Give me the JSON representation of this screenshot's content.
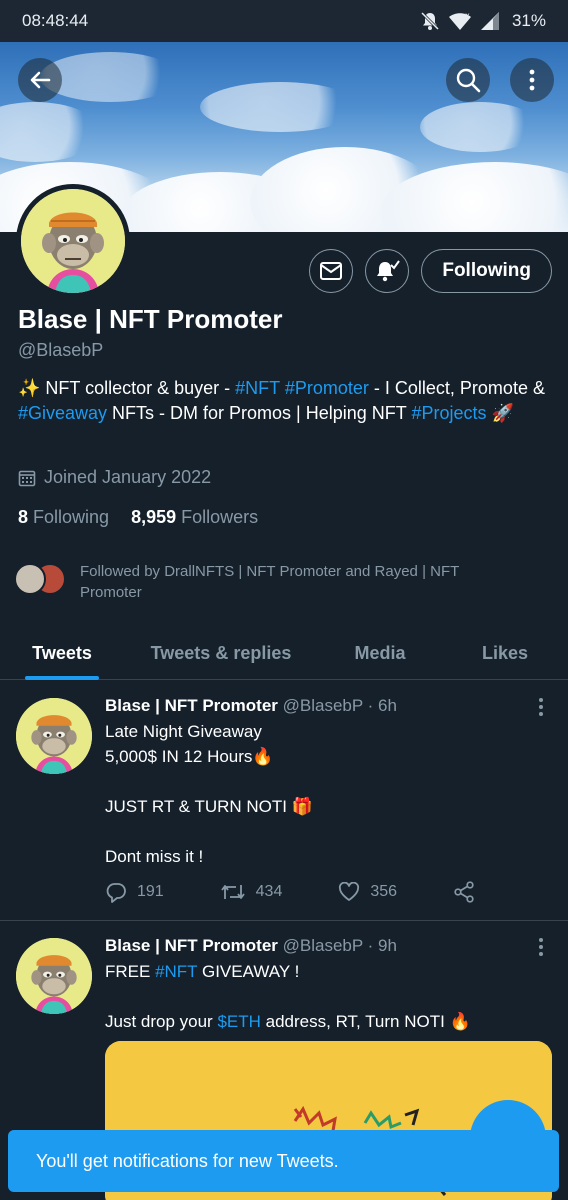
{
  "status_bar": {
    "time": "08:48:44",
    "battery": "31%"
  },
  "profile": {
    "name": "Blase | NFT Promoter",
    "handle": "@BlasebP",
    "bio": {
      "emoji_start": "✨",
      "t1": " NFT collector & buyer - ",
      "h1": "#NFT",
      "h2": "#Promoter",
      "t2": " - I Collect, Promote & ",
      "h3": "#Giveaway",
      "t3": " NFTs - DM for Promos | Helping NFT ",
      "h4": "#Projects",
      "emoji_end": "🚀"
    },
    "joined": "Joined January 2022",
    "following_count": "8",
    "following_label": "Following",
    "followers_count": "8,959",
    "followers_label": "Followers",
    "followed_by": "Followed by DrallNFTS | NFT Promoter and Rayed | NFT Promoter",
    "following_button": "Following"
  },
  "tabs": [
    "Tweets",
    "Tweets & replies",
    "Media",
    "Likes"
  ],
  "tweets": [
    {
      "name": "Blase | NFT Promoter",
      "handle": "@BlasebP",
      "time": "· 6h",
      "line1": "Late Night Giveaway",
      "line2": "5,000$ IN 12 Hours",
      "line2_emoji": "🔥",
      "line3": "JUST RT & TURN NOTI ",
      "line3_emoji": "🎁",
      "line4": "Dont miss it !",
      "replies": "191",
      "retweets": "434",
      "likes": "356"
    },
    {
      "name": "Blase | NFT Promoter",
      "handle": "@BlasebP",
      "time": "· 9h",
      "line1_a": "FREE ",
      "line1_tag": "#NFT",
      "line1_b": " GIVEAWAY !",
      "line2_a": "Just drop your ",
      "line2_tag": "$ETH",
      "line2_b": " address, RT, Turn NOTI ",
      "line2_emoji": "🔥"
    }
  ],
  "toast": "You'll get notifications for new Tweets.",
  "colors": {
    "accent": "#1d9bf0",
    "background": "#15202b",
    "muted": "#8899a6"
  }
}
